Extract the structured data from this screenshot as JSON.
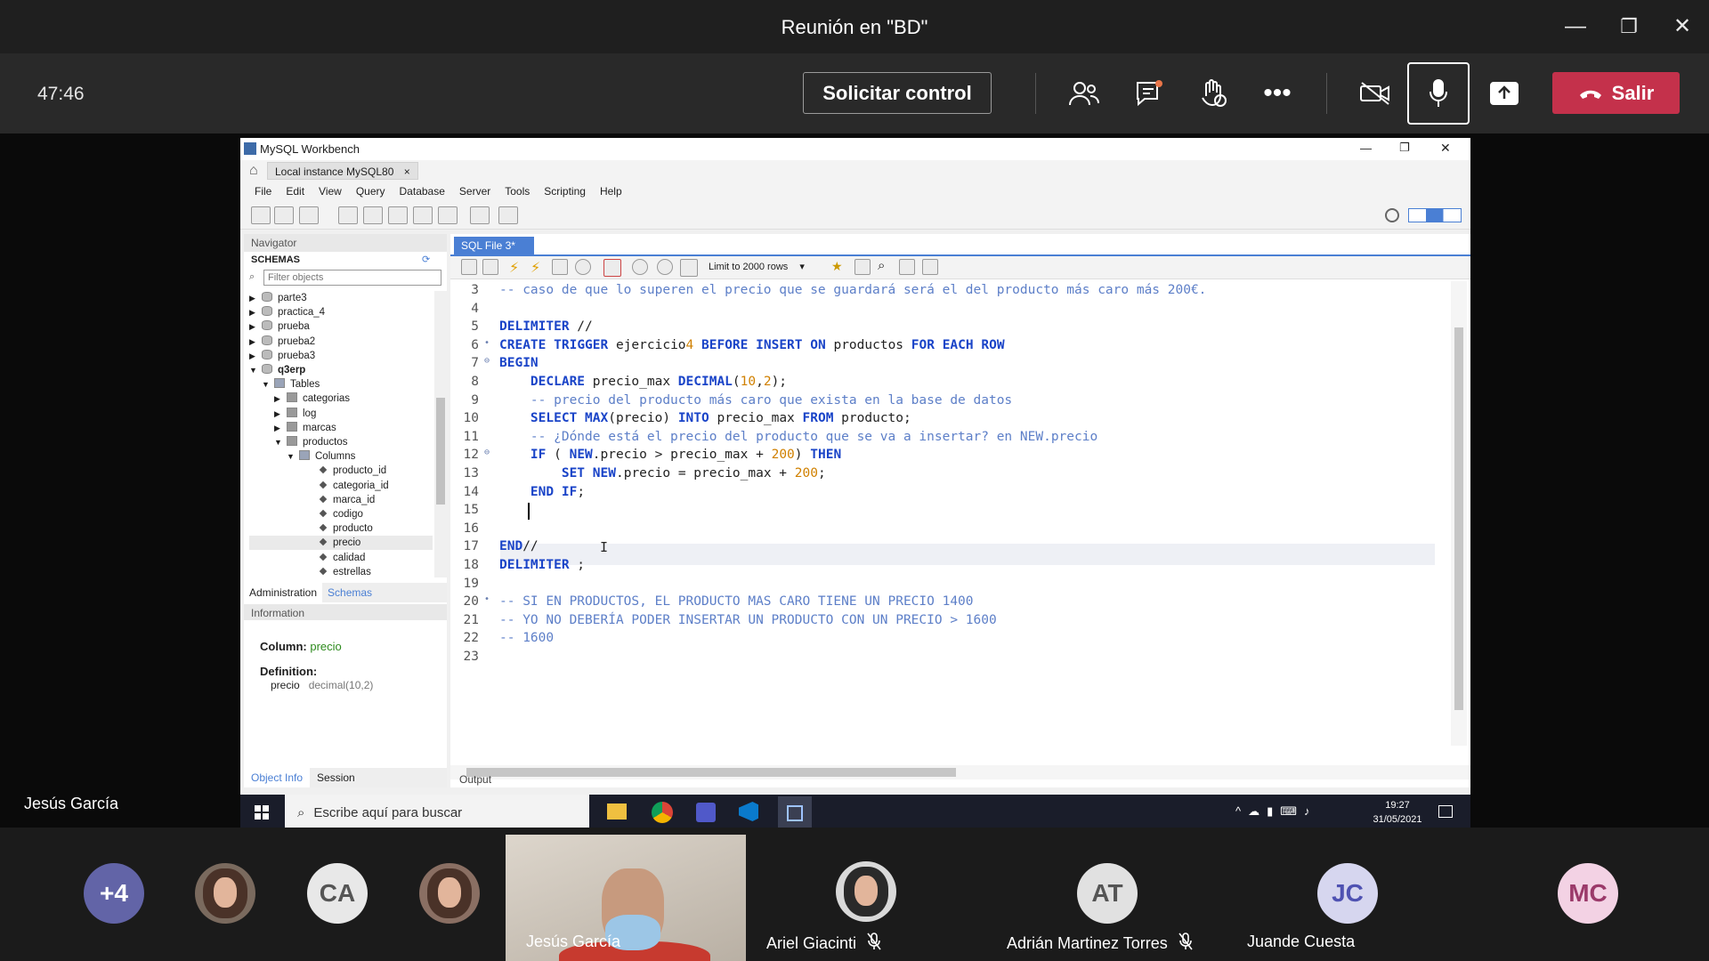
{
  "meeting": {
    "title": "Reunión en \"BD\"",
    "timer": "47:46",
    "control_label": "Solicitar control",
    "leave_label": "Salir",
    "presenter_name": "Jesús García"
  },
  "window_controls": {
    "minimize": "—",
    "restore": "❐",
    "close": "✕"
  },
  "workbench": {
    "title": "MySQL Workbench",
    "instance_tab": "Local instance MySQL80",
    "menu": [
      "File",
      "Edit",
      "View",
      "Query",
      "Database",
      "Server",
      "Tools",
      "Scripting",
      "Help"
    ],
    "navigator_label": "Navigator",
    "schemas_label": "SCHEMAS",
    "filter_placeholder": "Filter objects",
    "tree": [
      {
        "label": "parte3",
        "depth": 0,
        "kind": "db",
        "arrow": "▶"
      },
      {
        "label": "practica_4",
        "depth": 0,
        "kind": "db",
        "arrow": "▶"
      },
      {
        "label": "prueba",
        "depth": 0,
        "kind": "db",
        "arrow": "▶"
      },
      {
        "label": "prueba2",
        "depth": 0,
        "kind": "db",
        "arrow": "▶"
      },
      {
        "label": "prueba3",
        "depth": 0,
        "kind": "db",
        "arrow": "▶"
      },
      {
        "label": "q3erp",
        "depth": 0,
        "kind": "db",
        "arrow": "▼",
        "bold": true
      },
      {
        "label": "Tables",
        "depth": 1,
        "kind": "folder",
        "arrow": "▼"
      },
      {
        "label": "categorias",
        "depth": 2,
        "kind": "table",
        "arrow": "▶"
      },
      {
        "label": "log",
        "depth": 2,
        "kind": "table",
        "arrow": "▶"
      },
      {
        "label": "marcas",
        "depth": 2,
        "kind": "table",
        "arrow": "▶"
      },
      {
        "label": "productos",
        "depth": 2,
        "kind": "table",
        "arrow": "▼"
      },
      {
        "label": "Columns",
        "depth": 3,
        "kind": "folder",
        "arrow": "▼"
      },
      {
        "label": "producto_id",
        "depth": 4,
        "kind": "col",
        "arrow": ""
      },
      {
        "label": "categoria_id",
        "depth": 4,
        "kind": "col",
        "arrow": ""
      },
      {
        "label": "marca_id",
        "depth": 4,
        "kind": "col",
        "arrow": ""
      },
      {
        "label": "codigo",
        "depth": 4,
        "kind": "col",
        "arrow": ""
      },
      {
        "label": "producto",
        "depth": 4,
        "kind": "col",
        "arrow": ""
      },
      {
        "label": "precio",
        "depth": 4,
        "kind": "col",
        "arrow": "",
        "selected": true
      },
      {
        "label": "calidad",
        "depth": 4,
        "kind": "col",
        "arrow": ""
      },
      {
        "label": "estrellas",
        "depth": 4,
        "kind": "col",
        "arrow": ""
      }
    ],
    "nav_tabs": [
      "Administration",
      "Schemas"
    ],
    "information_label": "Information",
    "info": {
      "column_label": "Column:",
      "column_value": "precio",
      "definition_label": "Definition:",
      "def_name": "precio",
      "def_type": "decimal(10,2)"
    },
    "bottom_tabs": [
      "Object Info",
      "Session"
    ],
    "sql_tab": "SQL File 3*",
    "limit_label": "Limit to 2000 rows",
    "output_label": "Output",
    "code": [
      {
        "n": "3",
        "t": "-- caso de que lo superen el precio que se guardará será el del producto más caro más 200€."
      },
      {
        "n": "4",
        "t": ""
      },
      {
        "n": "5",
        "t": "DELIMITER //"
      },
      {
        "n": "6",
        "t": "CREATE TRIGGER ejercicio4 BEFORE INSERT ON productos FOR EACH ROW"
      },
      {
        "n": "7",
        "t": "BEGIN"
      },
      {
        "n": "8",
        "t": "    DECLARE precio_max DECIMAL(10,2);"
      },
      {
        "n": "9",
        "t": "    -- precio del producto más caro que exista en la base de datos"
      },
      {
        "n": "10",
        "t": "    SELECT MAX(precio) INTO precio_max FROM producto;"
      },
      {
        "n": "11",
        "t": "    -- ¿Dónde está el precio del producto que se va a insertar? en NEW.precio"
      },
      {
        "n": "12",
        "t": "    IF ( NEW.precio > precio_max + 200) THEN"
      },
      {
        "n": "13",
        "t": "        SET NEW.precio = precio_max + 200;"
      },
      {
        "n": "14",
        "t": "    END IF;"
      },
      {
        "n": "15",
        "t": "    "
      },
      {
        "n": "16",
        "t": ""
      },
      {
        "n": "17",
        "t": "END//"
      },
      {
        "n": "18",
        "t": "DELIMITER ;"
      },
      {
        "n": "19",
        "t": ""
      },
      {
        "n": "20",
        "t": "-- SI EN PRODUCTOS, EL PRODUCTO MAS CARO TIENE UN PRECIO 1400"
      },
      {
        "n": "21",
        "t": "-- YO NO DEBERÍA PODER INSERTAR UN PRODUCTO CON UN PRECIO > 1600"
      },
      {
        "n": "22",
        "t": "-- 1600"
      },
      {
        "n": "23",
        "t": ""
      }
    ]
  },
  "taskbar": {
    "search_placeholder": "Escribe aquí para buscar",
    "time": "19:27",
    "date": "31/05/2021"
  },
  "participants": [
    {
      "initials": "+4",
      "color": "#6264a7",
      "name": ""
    },
    {
      "initials": "",
      "color": "#7a6a5e",
      "name": "",
      "photo": true
    },
    {
      "initials": "CA",
      "color": "#e8e8e8",
      "name": ""
    },
    {
      "initials": "",
      "color": "#8a6f63",
      "name": "",
      "photo": true
    },
    {
      "initials": "",
      "color": "#c8c2b8",
      "name": "Jesús García",
      "video": true
    },
    {
      "initials": "",
      "color": "#d9d9d9",
      "name": "Ariel Giacinti",
      "photo": true,
      "muted": true
    },
    {
      "initials": "AT",
      "color": "#e1e1e1",
      "name": "Adrián Martinez Torres",
      "muted": true
    },
    {
      "initials": "JC",
      "color": "#d6d6ef",
      "name": "Juande Cuesta"
    },
    {
      "initials": "MC",
      "color": "#f3d2e4",
      "name": ""
    }
  ],
  "colors": {
    "accent": "#6264a7",
    "leave": "#c4314b",
    "keyword": "#1a44c8",
    "comment": "#5d7fc8"
  }
}
